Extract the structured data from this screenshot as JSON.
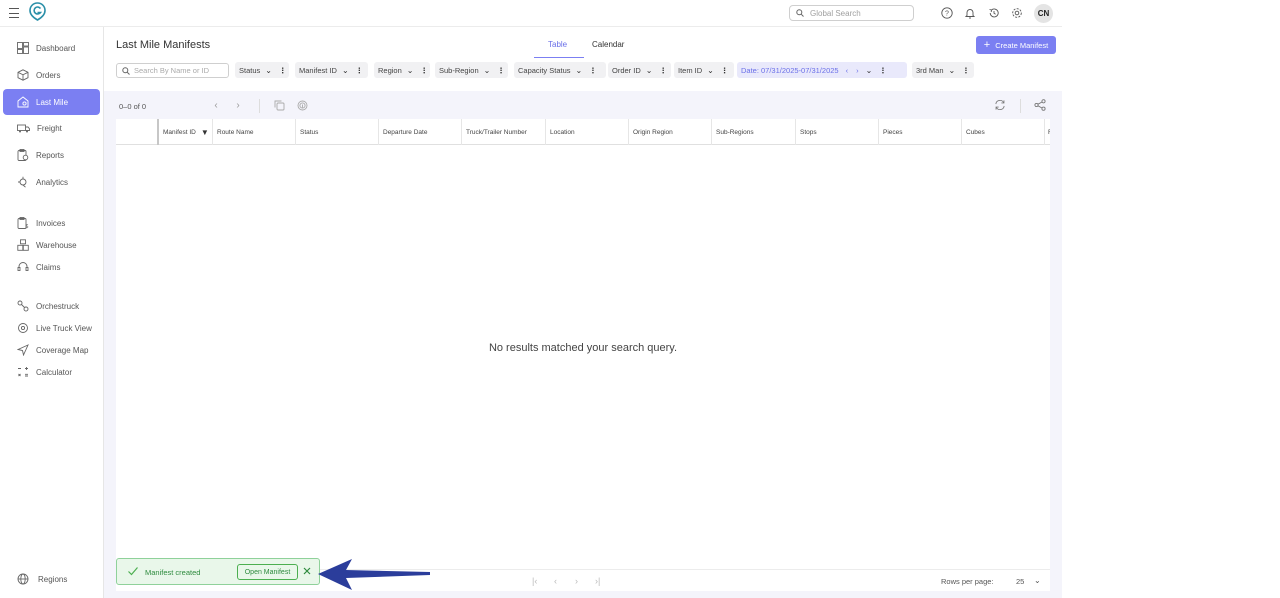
{
  "topbar": {
    "search_placeholder": "Global Search",
    "avatar_initials": "CN",
    "icons": [
      "help-icon",
      "bell-icon",
      "history-icon",
      "settings-icon"
    ]
  },
  "sidebar": {
    "items": [
      {
        "label": "Dashboard",
        "icon": "dashboard-icon"
      },
      {
        "label": "Orders",
        "icon": "orders-icon"
      },
      {
        "label": "Last Mile",
        "icon": "last-mile-icon",
        "active": true
      },
      {
        "label": "Freight",
        "icon": "freight-icon"
      },
      {
        "label": "Reports",
        "icon": "reports-icon"
      },
      {
        "label": "Analytics",
        "icon": "analytics-icon"
      },
      {
        "label": "Invoices",
        "icon": "invoices-icon"
      },
      {
        "label": "Warehouse",
        "icon": "warehouse-icon"
      },
      {
        "label": "Claims",
        "icon": "claims-icon"
      },
      {
        "label": "Orchestruck",
        "icon": "orchestruck-icon"
      },
      {
        "label": "Live Truck View",
        "icon": "live-truck-icon"
      },
      {
        "label": "Coverage Map",
        "icon": "coverage-map-icon"
      },
      {
        "label": "Calculator",
        "icon": "calculator-icon"
      }
    ],
    "bottom": {
      "label": "Regions",
      "icon": "globe-icon"
    }
  },
  "main": {
    "title": "Last Mile Manifests",
    "tabs": [
      {
        "label": "Table",
        "active": true
      },
      {
        "label": "Calendar",
        "active": false
      }
    ],
    "create_button": "Create Manifest",
    "search_placeholder": "Search By Name or ID",
    "filters": [
      {
        "label": "Status"
      },
      {
        "label": "Manifest ID"
      },
      {
        "label": "Region"
      },
      {
        "label": "Sub-Region"
      },
      {
        "label": "Capacity Status"
      },
      {
        "label": "Order ID"
      },
      {
        "label": "Item ID"
      },
      {
        "label": "Date: 07/31/2025-07/31/2025"
      },
      {
        "label": "3rd Man"
      }
    ]
  },
  "table": {
    "range": "0–0 of 0",
    "columns": [
      "Manifest ID",
      "Route Name",
      "Status",
      "Departure Date",
      "Truck/Trailer Number",
      "Location",
      "Origin Region",
      "Sub-Regions",
      "Stops",
      "Pieces",
      "Cubes",
      "R"
    ],
    "empty_message": "No results matched your search query.",
    "rows_per_page_label": "Rows per page:",
    "rows_per_page_value": "25"
  },
  "toast": {
    "message": "Manifest created",
    "button": "Open Manifest"
  },
  "colors": {
    "accent": "#7b7ff2",
    "success": "#2e8b3e",
    "annotation_arrow": "#2b3d9b"
  }
}
